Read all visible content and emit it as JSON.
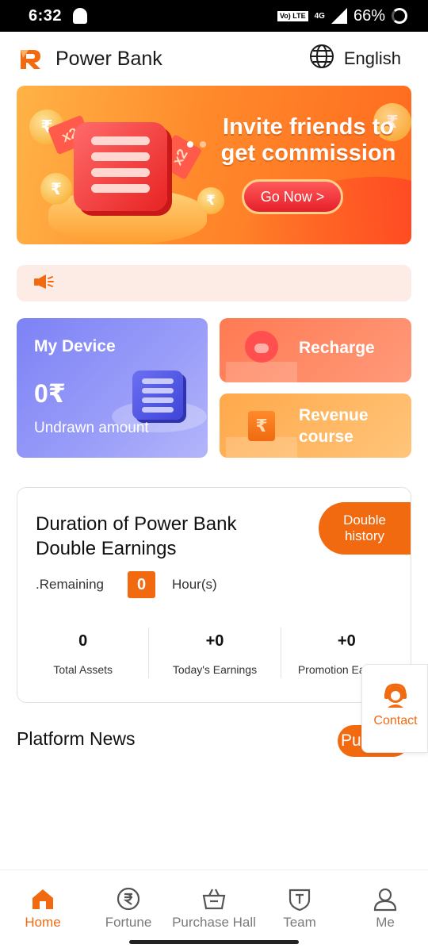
{
  "status_bar": {
    "time": "6:32",
    "volte_label": "Vo) LTE",
    "network_label": "4G",
    "battery_percent": "66%"
  },
  "header": {
    "title": "Power Bank",
    "language_label": "English"
  },
  "banner": {
    "headline": "Invite friends to get commission",
    "cta_label": "Go Now >",
    "coin_symbol": "₹",
    "ticket_label": "x2",
    "slide_count": 2,
    "active_slide": 1
  },
  "notice": {
    "text": ""
  },
  "tiles": {
    "device": {
      "title": "My Device",
      "amount": "0₹",
      "subtitle": "Undrawn amount"
    },
    "recharge": {
      "label": "Recharge"
    },
    "revenue": {
      "label": "Revenue course",
      "icon_symbol": "₹"
    }
  },
  "earnings_card": {
    "title": "Duration of Power Bank Double Earnings",
    "history_button": "Double history",
    "remaining_label": ".Remaining",
    "hours_value": "0",
    "hours_unit": "Hour(s)",
    "stats": [
      {
        "value": "0",
        "label": "Total Assets"
      },
      {
        "value": "+0",
        "label": "Today's Earnings"
      },
      {
        "value": "+0",
        "label": "Promotion Earnings"
      }
    ]
  },
  "contact": {
    "label": "Contact"
  },
  "news": {
    "title": "Platform News",
    "pill_label": "Pu"
  },
  "bottom_nav": {
    "items": [
      {
        "label": "Home",
        "icon": "home-icon",
        "active": true
      },
      {
        "label": "Fortune",
        "icon": "rupee-circle-icon",
        "active": false
      },
      {
        "label": "Purchase Hall",
        "icon": "shopping-basket-icon",
        "active": false
      },
      {
        "label": "Team",
        "icon": "team-shield-icon",
        "active": false
      },
      {
        "label": "Me",
        "icon": "user-icon",
        "active": false
      }
    ]
  },
  "colors": {
    "accent": "#f26a10",
    "device_tile": "#8a8ef7",
    "recharge_tile": "#ff8560",
    "revenue_tile": "#ffb258",
    "notice_bg": "#fdece6"
  }
}
